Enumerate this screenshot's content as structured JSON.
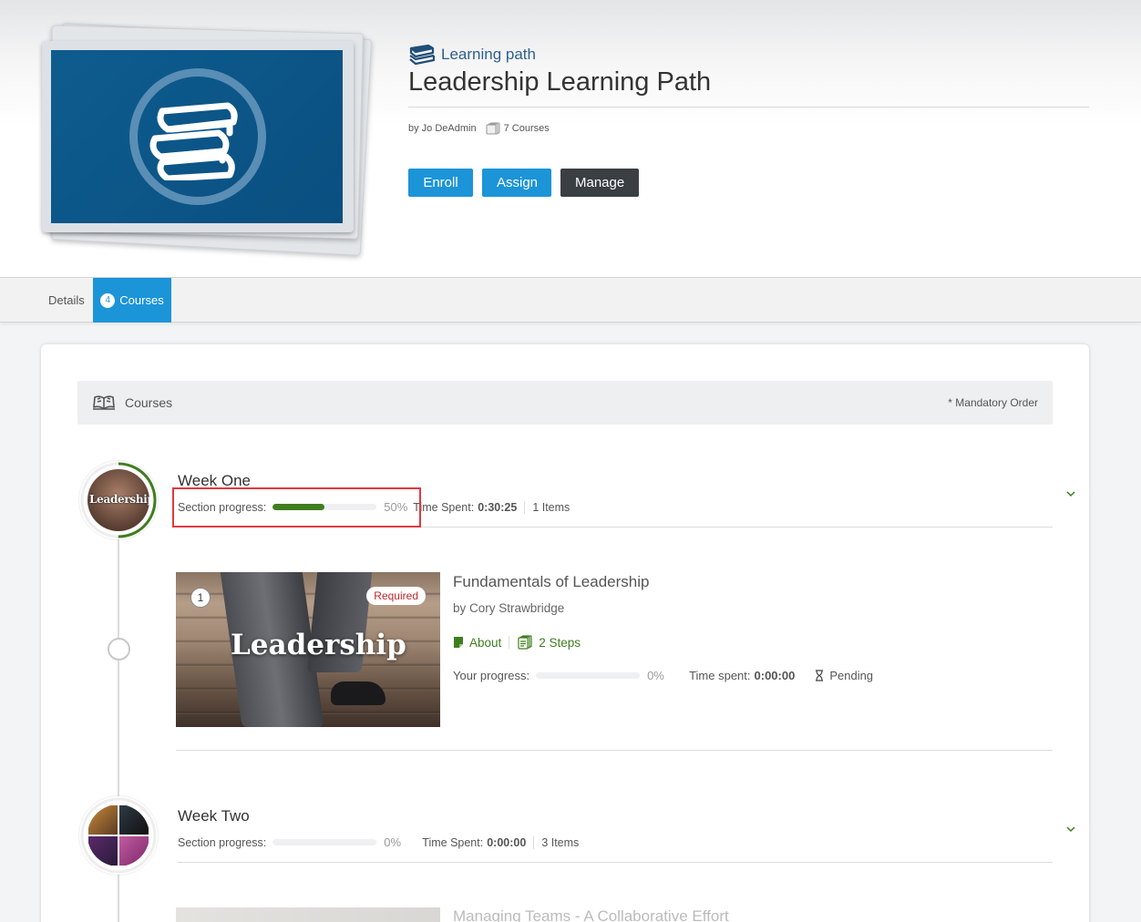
{
  "header": {
    "type_label": "Learning path",
    "title": "Leadership Learning Path",
    "author": "by Jo DeAdmin",
    "course_count": "7 Courses",
    "buttons": {
      "enroll": "Enroll",
      "assign": "Assign",
      "manage": "Manage"
    }
  },
  "tabs": {
    "details": "Details",
    "courses_badge": "4",
    "courses": "Courses"
  },
  "courses_bar": {
    "label": "Courses",
    "mandatory": "* Mandatory Order"
  },
  "sections": [
    {
      "title": "Week One",
      "thumb_word": "Leadership",
      "progress_label": "Section progress:",
      "progress_value": 50,
      "progress_text": "50%",
      "time_label": "Time Spent:",
      "time_value": "0:30:25",
      "items": "1 Items",
      "courses": [
        {
          "number": "1",
          "badge": "Required",
          "thumb_word": "Leadership",
          "title": "Fundamentals of Leadership",
          "author": "by Cory Strawbridge",
          "about": "About",
          "steps": "2 Steps",
          "progress_label": "Your progress:",
          "progress_value": 0,
          "progress_text": "0%",
          "time_label": "Time spent:",
          "time_value": "0:00:00",
          "status": "Pending"
        }
      ]
    },
    {
      "title": "Week Two",
      "progress_label": "Section progress:",
      "progress_value": 0,
      "progress_text": "0%",
      "time_label": "Time Spent:",
      "time_value": "0:00:00",
      "items": "3 Items",
      "next_course_title": "Managing Teams - A Collaborative Effort"
    }
  ],
  "colors": {
    "accent_blue": "#1c94d8",
    "dark_button": "#3a3f44",
    "progress_green": "#3f7e1f",
    "highlight_red": "#e0393f",
    "title_blue": "#2f5f8c"
  }
}
